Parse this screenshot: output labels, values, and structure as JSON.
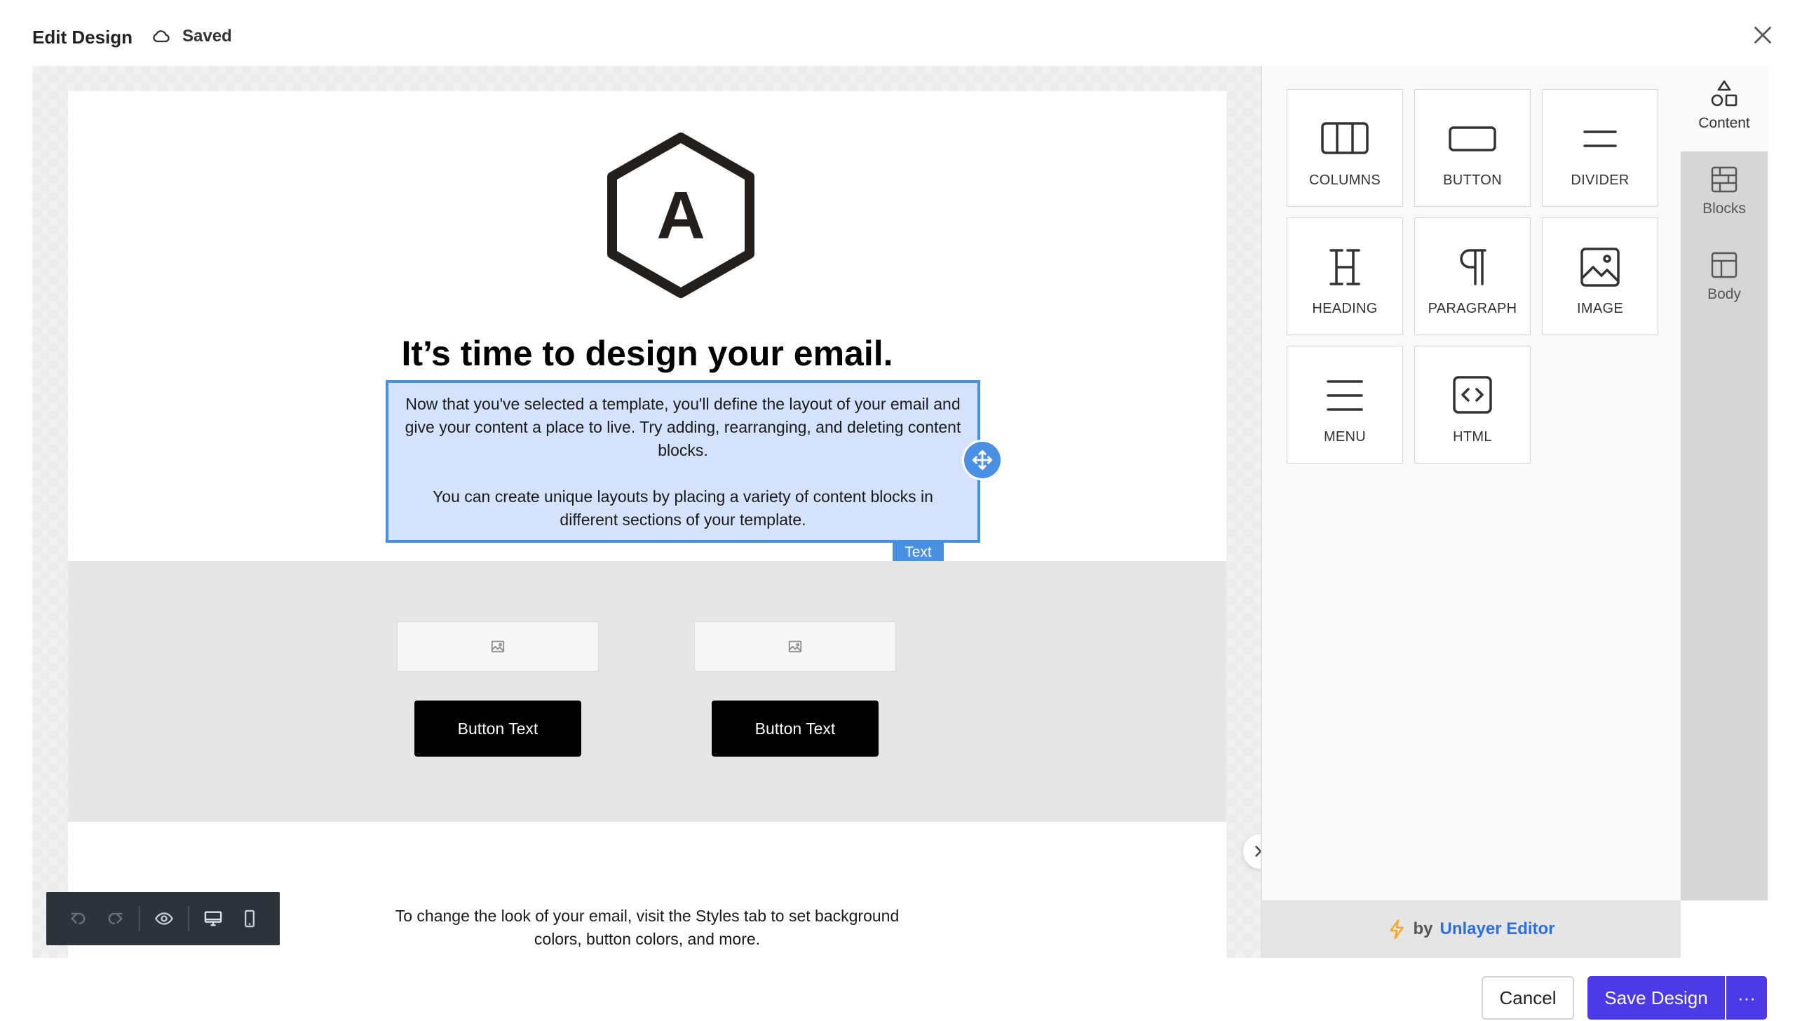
{
  "header": {
    "title": "Edit Design",
    "status": "Saved"
  },
  "email": {
    "logo_letter": "A",
    "headline": "It’s time to design your email.",
    "text_block": {
      "paragraph_1": "Now that you've selected a template, you'll define the layout of your email and give your content a place to live. Try adding, rearranging, and deleting content blocks.",
      "paragraph_2": "You can create unique layouts by placing a variety of content blocks in different sections of your template.",
      "tag": "Text"
    },
    "buttons": [
      "Button Text",
      "Button Text"
    ],
    "footer_line_1": "To change the look of your email, visit the Styles tab to set background",
    "footer_line_2": "colors, button colors, and more."
  },
  "tools": [
    {
      "label": "COLUMNS",
      "icon": "columns-icon"
    },
    {
      "label": "BUTTON",
      "icon": "button-icon"
    },
    {
      "label": "DIVIDER",
      "icon": "divider-icon"
    },
    {
      "label": "HEADING",
      "icon": "heading-icon"
    },
    {
      "label": "PARAGRAPH",
      "icon": "paragraph-icon"
    },
    {
      "label": "IMAGE",
      "icon": "image-icon"
    },
    {
      "label": "MENU",
      "icon": "menu-icon"
    },
    {
      "label": "HTML",
      "icon": "html-icon"
    }
  ],
  "tabs": [
    {
      "label": "Content",
      "icon": "shapes-icon",
      "active": true
    },
    {
      "label": "Blocks",
      "icon": "blocks-icon",
      "active": false
    },
    {
      "label": "Body",
      "icon": "layout-icon",
      "active": false
    }
  ],
  "panel_footer": {
    "by": "by",
    "brand": "Unlayer Editor"
  },
  "actions": {
    "cancel": "Cancel",
    "save": "Save Design",
    "more": "···"
  },
  "colors": {
    "accent": "#4b3ae6",
    "selection": "#4a90e2",
    "selection_fill": "#d5e2fb",
    "brand_link": "#2f6fdd",
    "lightning": "#f5a623"
  }
}
